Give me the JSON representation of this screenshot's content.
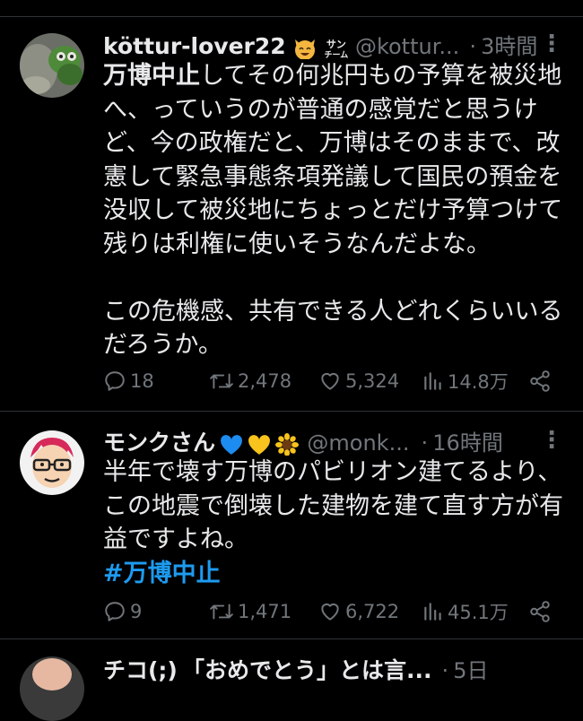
{
  "tweets": [
    {
      "name": "köttur-lover22",
      "badge_text_top": "サン",
      "badge_text_bottom": "チーム",
      "handle": "@kottur...",
      "dot": "·",
      "time": "3時間",
      "text_bold": "万博中止",
      "text_rest": "してその何兆円もの予算を被災地へ、っていうのが普通の感覚だと思うけど、今の政権だと、万博はそのままで、改憲して緊急事態条項発議して国民の預金を没収して被災地にちょっとだけ予算つけて残りは利権に使いそうなんだよな。\n\nこの危機感、共有できる人どれくらいいるだろうか。",
      "replies": "18",
      "retweets": "2,478",
      "likes": "5,324",
      "views": "14.8万"
    },
    {
      "name": "モンクさん",
      "handle": "@monk...",
      "dot": "·",
      "time": "16時間",
      "text": "半年で壊す万博のパビリオン建てるより、この地震で倒壊した建物を建て直す方が有益ですよね。",
      "hashtag": "#万博中止",
      "replies": "9",
      "retweets": "1,471",
      "likes": "6,722",
      "views": "45.1万"
    },
    {
      "name": "チコ(;)",
      "text_start": "「おめでとう」とは言...",
      "dot": "·",
      "time": "5日"
    }
  ],
  "colors": {
    "background": "#000000",
    "text": "#e7e9ea",
    "muted": "#71767b",
    "hashtag": "#1d9bf0",
    "divider": "#2f3336"
  }
}
